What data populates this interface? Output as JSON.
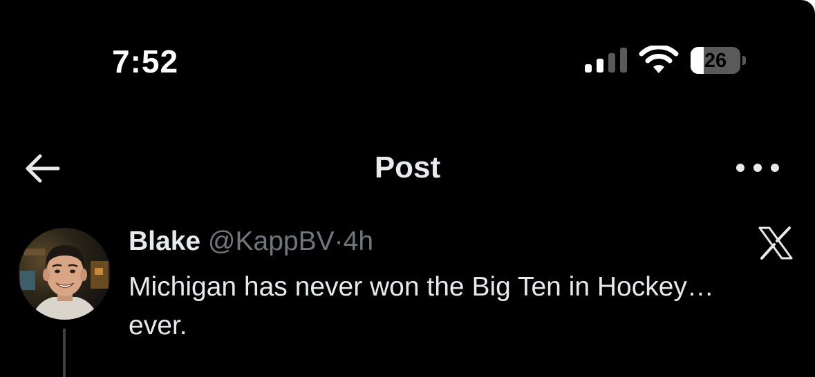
{
  "status_bar": {
    "time": "7:52",
    "battery_level": "26",
    "battery_fraction": 0.26,
    "icons": [
      "cellular-signal-icon",
      "wifi-icon",
      "battery-icon"
    ]
  },
  "nav": {
    "title": "Post",
    "back_icon": "arrow-left-icon",
    "more_icon": "more-horizontal-icon"
  },
  "post": {
    "display_name": "Blake",
    "handle": "@KappBV",
    "separator": "·",
    "time_ago": "4h",
    "text_lines": [
      "Michigan has never won the Big Ten in Hockey…",
      "ever."
    ],
    "avatar_icon": "user-avatar",
    "brand_icon": "x-logo-icon"
  },
  "colors": {
    "background": "#000000",
    "primary_text": "#e7e9ea",
    "secondary_text": "#71767b",
    "thread_line": "#3e4144"
  }
}
